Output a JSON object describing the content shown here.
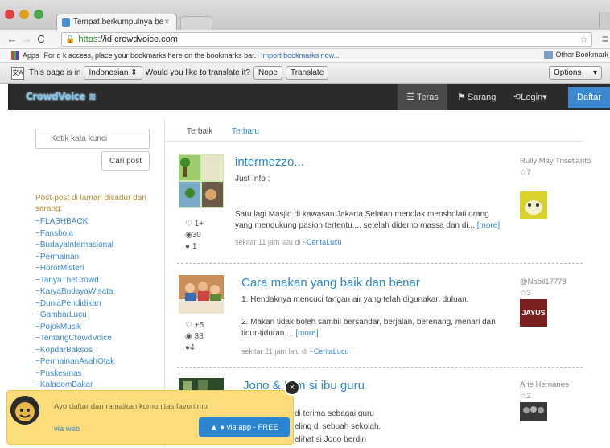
{
  "browser": {
    "tab_title": "Tempat berkumpulnya be",
    "url_scheme": "https",
    "url_rest": "://id.crowdvoice.com",
    "bookmarks_apps": "Apps",
    "bookmarks_hint": "For q  k access, place your bookmarks here on the bookmarks bar.",
    "bookmarks_import": "Import bookmarks now...",
    "other_bookmarks": "Other Bookmark",
    "translate": {
      "prefix": "This page is in",
      "language": "Indonesian",
      "question": "Would you like to translate it?",
      "nope": "Nope",
      "translate_btn": "Translate",
      "options": "Options"
    }
  },
  "header": {
    "logo": "CrowdVoice",
    "nav": {
      "teras": "Teras",
      "sarang": "Sarang",
      "login": "Login",
      "daftar": "Daftar"
    }
  },
  "sidebar": {
    "search_placeholder": "Ketik kata kunci",
    "search_button": "Cari post",
    "intro": "Post-post di laman disadur dari sarang:",
    "items": [
      "~FLASHBACK",
      "~Fansbola",
      "~BudayaInternasional",
      "~Permainan",
      "~HororMisteri",
      "~TanyaTheCrowd",
      "~KaryaBudayaWisata",
      "~DuniaPendidikan",
      "~GambarLucu",
      "~PojokMusik",
      "~TentangCrowdVoice",
      "~KopdarBaksos",
      "~PermainanAsahOtak",
      "~Puskesmas",
      "~KaladomBakar"
    ]
  },
  "content": {
    "tabs": [
      "Terbaik",
      "Terbaru"
    ],
    "posts": [
      {
        "title": "intermezzo...",
        "line1": "Just Info :",
        "body": "Satu lagi Masjid di kawasan Jakarta Selatan menolak mensholati orang yang mendukung pasion tertentu.... setelah didemo massa dan di...",
        "more": "[more]",
        "meta": "sekitar 11 jam lalu di ",
        "category": "~CeritaLucu",
        "likes": "1+",
        "views": "30",
        "comments": "1",
        "author": "Rully May Trisetianto",
        "author_stars": "7"
      },
      {
        "title": "Cara makan yang baik dan benar",
        "line1": "1. Hendaknya mencuci tangan air yang telah digunakan duluan.",
        "body": "2. Makan tidak boleh sambil bersandar, berjalan, berenang, menari dan tidur-tiduran....",
        "more": "[more]",
        "meta": "sekitar 21 jam lalu di ",
        "category": "~CeritaLucu",
        "likes": "+5",
        "views": "33",
        "comments": "4",
        "author": "@Nabil17778",
        "author_stars": "3",
        "avatar_text": "JAYUS"
      },
      {
        "title": "Jono & B  m si ibu guru",
        "body1": "di terima sebagai guru",
        "body2": "eling di sebuah sekolah.",
        "body3": "elihat si Jono berdiri",
        "author": "Arie Hernanes",
        "author_stars": "2"
      }
    ]
  },
  "popup": {
    "text": "Ayo daftar dan ramaikan komunitas favoritmu",
    "web": "via web",
    "app": "via app - FREE",
    "close": "×"
  },
  "colors": {
    "accent": "#3b88d0",
    "header_bg": "#2b2b2b",
    "popup_bg": "#fbdc7a"
  }
}
